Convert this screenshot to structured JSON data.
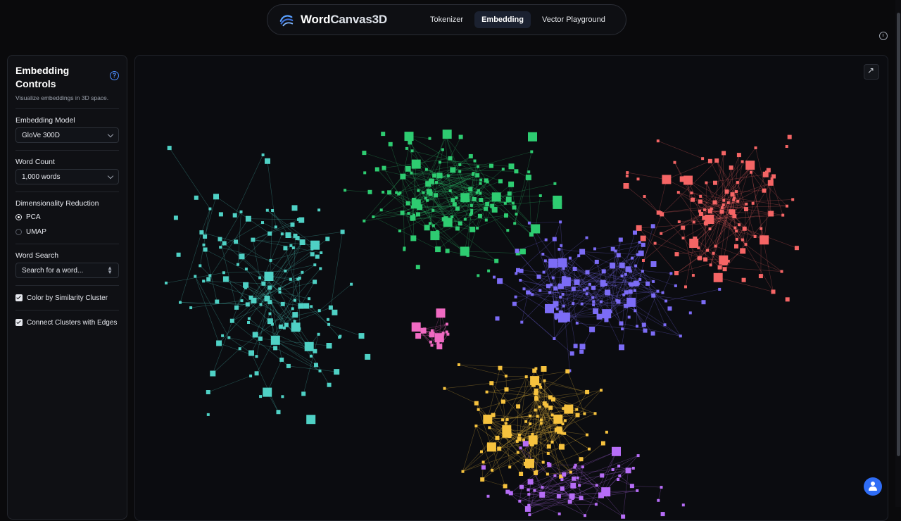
{
  "nav": {
    "brand_word": "Word",
    "brand_canvas": "Canvas3D",
    "tabs": [
      {
        "label": "Tokenizer",
        "active": false
      },
      {
        "label": "Embedding",
        "active": true
      },
      {
        "label": "Vector Playground",
        "active": false
      }
    ]
  },
  "sidebar": {
    "title": "Embedding Controls",
    "subtitle": "Visualize embeddings in 3D space.",
    "model": {
      "label": "Embedding Model",
      "value": "GloVe 300D"
    },
    "word_count": {
      "label": "Word Count",
      "value": "1,000 words"
    },
    "reduction": {
      "label": "Dimensionality Reduction",
      "options": [
        "PCA",
        "UMAP"
      ],
      "selected": "PCA"
    },
    "search": {
      "label": "Word Search",
      "placeholder": "Search for a word..."
    },
    "color_by_cluster": {
      "label": "Color by Similarity Cluster",
      "checked": true
    },
    "connect_edges": {
      "label": "Connect Clusters with Edges",
      "checked": true
    }
  },
  "colors": {
    "accent": "#2f6df6",
    "clusters": [
      "#4fd1c5",
      "#2ecc71",
      "#f56565",
      "#7c6cf6",
      "#f6c23e",
      "#b66df6",
      "#f06ac2"
    ]
  },
  "icons": {
    "brand": "wave-logo-icon",
    "help": "help-circle-icon",
    "expand": "expand-icon",
    "fab": "user-icon"
  }
}
